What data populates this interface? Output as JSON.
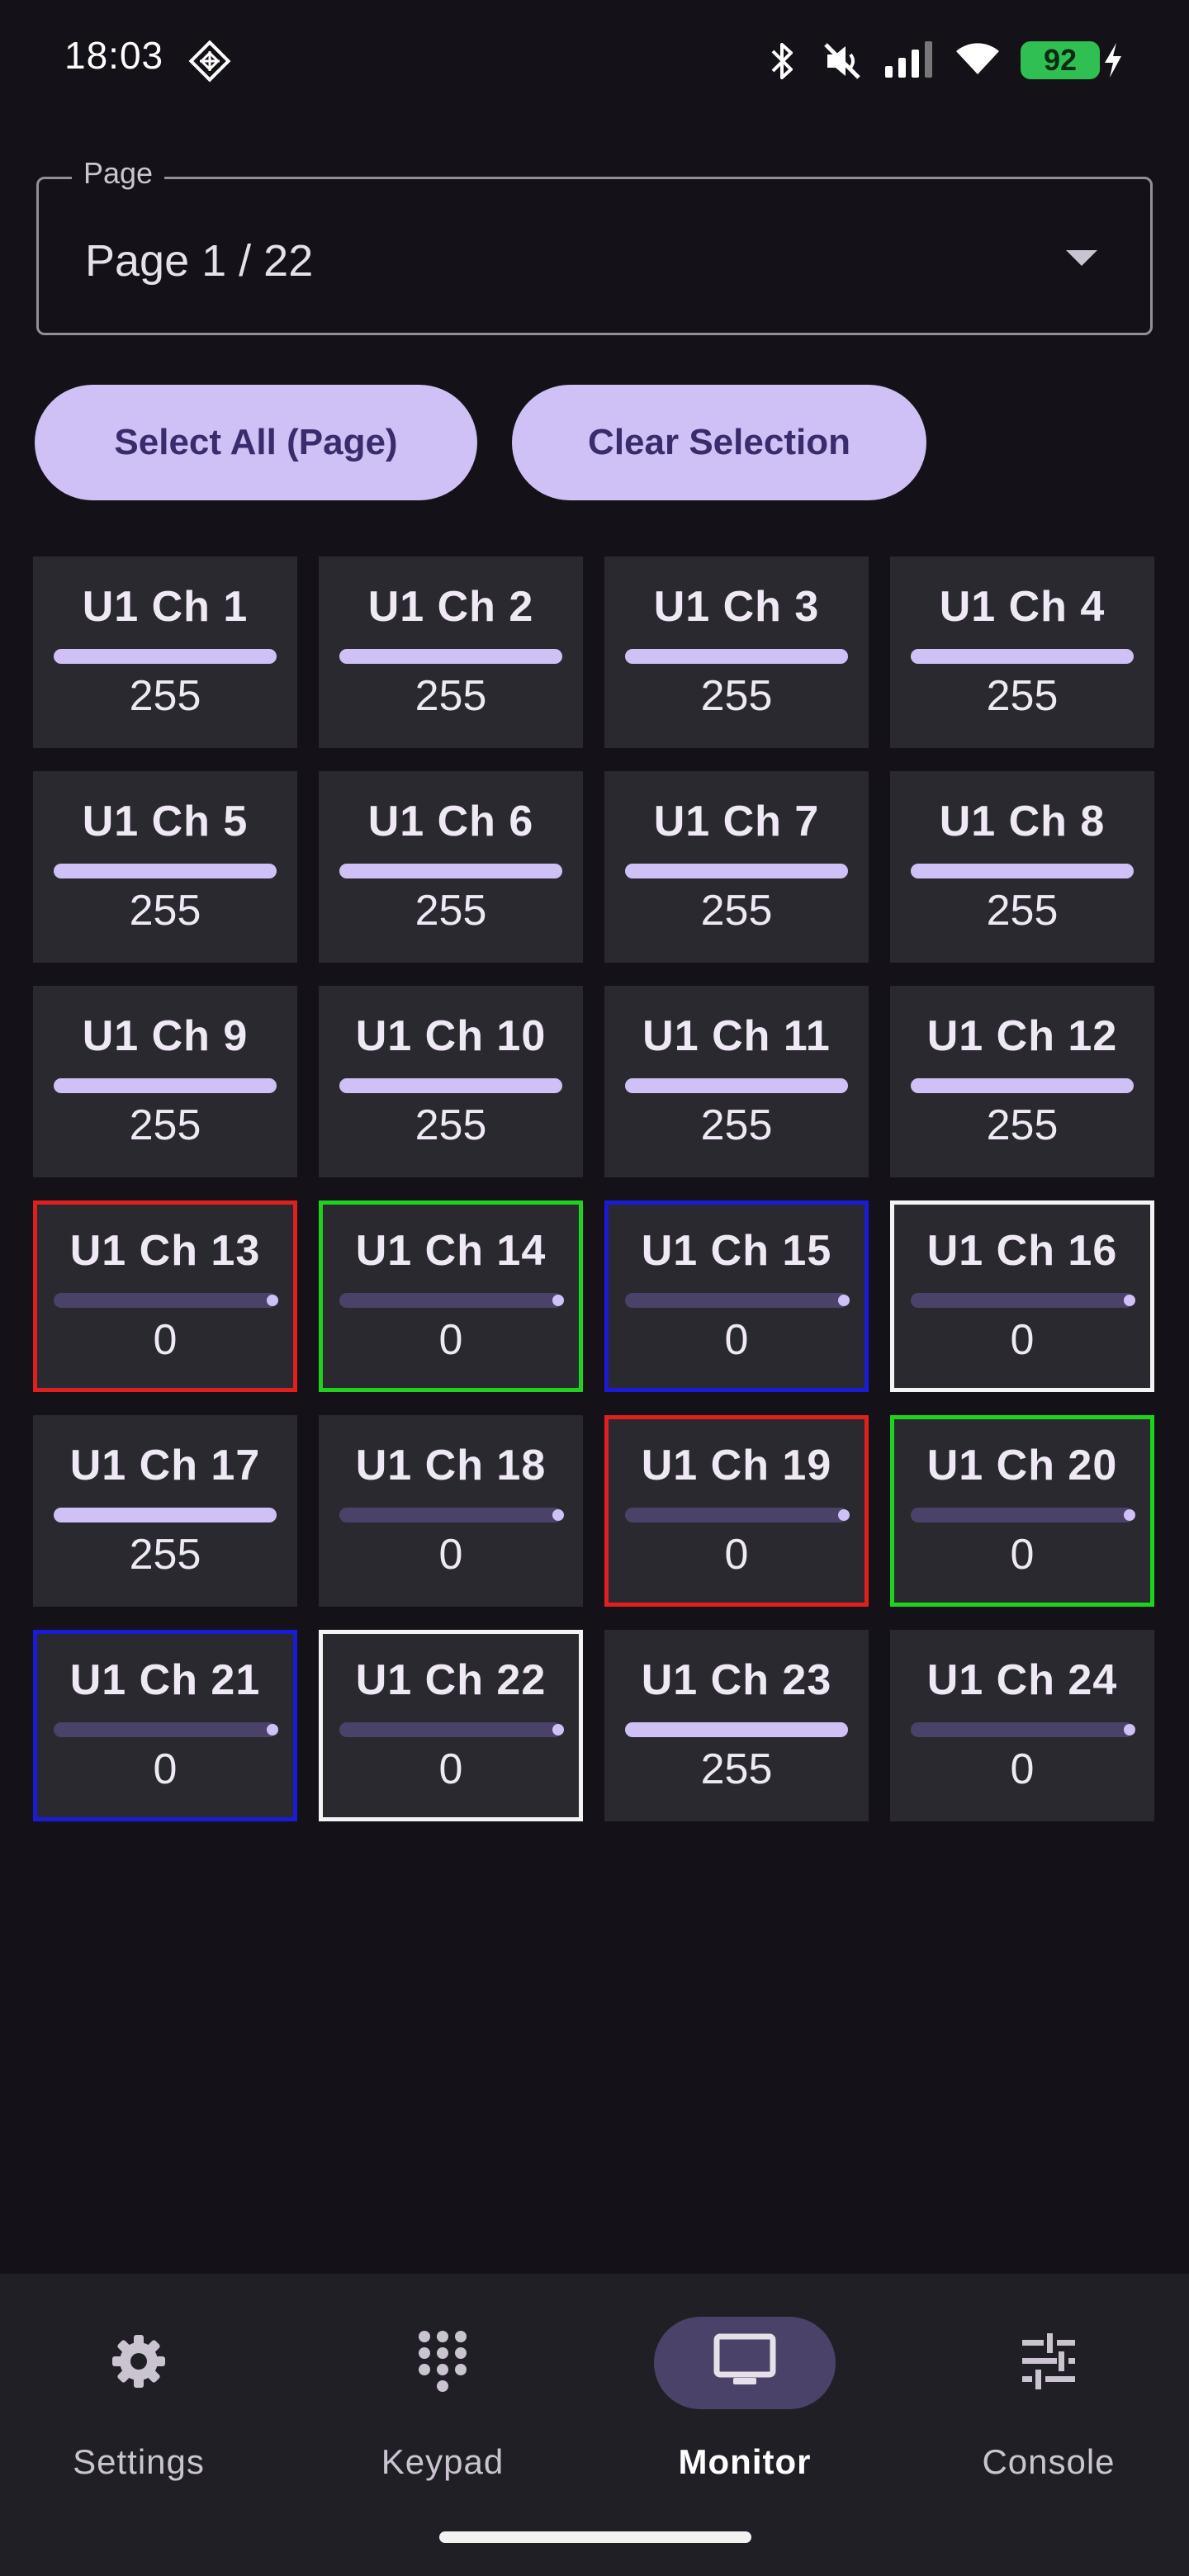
{
  "status_bar": {
    "time": "18:03",
    "battery": "92",
    "icons": [
      "data-saver-icon",
      "bluetooth-icon",
      "mute-icon",
      "signal-icon",
      "wifi-icon",
      "battery-icon",
      "charging-icon"
    ]
  },
  "page_select": {
    "label": "Page",
    "value": "Page 1 / 22"
  },
  "actions": {
    "select_all": "Select All (Page)",
    "clear_selection": "Clear Selection"
  },
  "channels": [
    {
      "label": "U1 Ch 1",
      "value": "255",
      "level": 1.0,
      "highlight": "none"
    },
    {
      "label": "U1 Ch 2",
      "value": "255",
      "level": 1.0,
      "highlight": "none"
    },
    {
      "label": "U1 Ch 3",
      "value": "255",
      "level": 1.0,
      "highlight": "none"
    },
    {
      "label": "U1 Ch 4",
      "value": "255",
      "level": 1.0,
      "highlight": "none"
    },
    {
      "label": "U1 Ch 5",
      "value": "255",
      "level": 1.0,
      "highlight": "none"
    },
    {
      "label": "U1 Ch 6",
      "value": "255",
      "level": 1.0,
      "highlight": "none"
    },
    {
      "label": "U1 Ch 7",
      "value": "255",
      "level": 1.0,
      "highlight": "none"
    },
    {
      "label": "U1 Ch 8",
      "value": "255",
      "level": 1.0,
      "highlight": "none"
    },
    {
      "label": "U1 Ch 9",
      "value": "255",
      "level": 1.0,
      "highlight": "none"
    },
    {
      "label": "U1 Ch 10",
      "value": "255",
      "level": 1.0,
      "highlight": "none"
    },
    {
      "label": "U1 Ch 11",
      "value": "255",
      "level": 1.0,
      "highlight": "none"
    },
    {
      "label": "U1 Ch 12",
      "value": "255",
      "level": 1.0,
      "highlight": "none"
    },
    {
      "label": "U1 Ch 13",
      "value": "0",
      "level": 0,
      "highlight": "red"
    },
    {
      "label": "U1 Ch 14",
      "value": "0",
      "level": 0,
      "highlight": "green"
    },
    {
      "label": "U1 Ch 15",
      "value": "0",
      "level": 0,
      "highlight": "blue"
    },
    {
      "label": "U1 Ch 16",
      "value": "0",
      "level": 0,
      "highlight": "white"
    },
    {
      "label": "U1 Ch 17",
      "value": "255",
      "level": 1.0,
      "highlight": "none"
    },
    {
      "label": "U1 Ch 18",
      "value": "0",
      "level": 0,
      "highlight": "none"
    },
    {
      "label": "U1 Ch 19",
      "value": "0",
      "level": 0,
      "highlight": "red"
    },
    {
      "label": "U1 Ch 20",
      "value": "0",
      "level": 0,
      "highlight": "green"
    },
    {
      "label": "U1 Ch 21",
      "value": "0",
      "level": 0,
      "highlight": "blue"
    },
    {
      "label": "U1 Ch 22",
      "value": "0",
      "level": 0,
      "highlight": "white"
    },
    {
      "label": "U1 Ch 23",
      "value": "255",
      "level": 1.0,
      "highlight": "none"
    },
    {
      "label": "U1 Ch 24",
      "value": "0",
      "level": 0,
      "highlight": "none"
    }
  ],
  "nav": {
    "items": [
      {
        "label": "Settings",
        "icon": "gear-icon",
        "active": false
      },
      {
        "label": "Keypad",
        "icon": "dialpad-icon",
        "active": false
      },
      {
        "label": "Monitor",
        "icon": "monitor-icon",
        "active": true
      },
      {
        "label": "Console",
        "icon": "sliders-icon",
        "active": false
      }
    ]
  },
  "colors": {
    "background": "#141218",
    "tile": "#2b2930",
    "accent": "#cfc0f5",
    "highlight_red": "#e01f1f",
    "highlight_green": "#1fd21f",
    "highlight_blue": "#1b1bd6",
    "highlight_white": "#f4f4f4"
  }
}
